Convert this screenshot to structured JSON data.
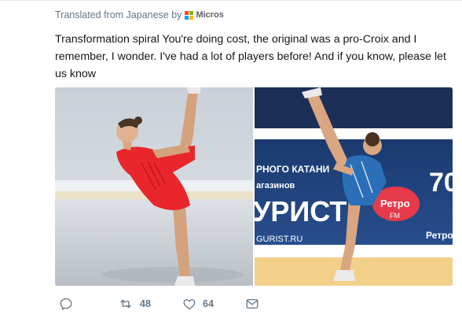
{
  "translation": {
    "label": "Translated from Japanese by",
    "brand": "Micros",
    "logo_colors": [
      "#f25022",
      "#7fba00",
      "#00a4ef",
      "#ffb900"
    ]
  },
  "tweet": {
    "text": "Transformation spiral You're doing cost, the original was a pro-Croix and I remember, I wonder. I've had a lot of players before! And if you know, please let us know"
  },
  "media": {
    "photo_left_icon": "skater-red-dress-photo",
    "photo_right": {
      "icon": "skater-blue-dress-photo",
      "banner_line1": "РНОГО КАТАНИ",
      "banner_line2": "агазинов",
      "banner_big": "УРИСТ",
      "banner_url": "GURIST.RU",
      "retro_logo": "Ретро",
      "retro_sub": "FM",
      "side_number": "70",
      "side_text": "Ретро"
    }
  },
  "actions": {
    "reply": {
      "icon": "reply-icon",
      "count": ""
    },
    "retweet": {
      "icon": "retweet-icon",
      "count": "48"
    },
    "like": {
      "icon": "heart-icon",
      "count": "64"
    },
    "dm": {
      "icon": "envelope-icon",
      "count": ""
    }
  },
  "colors": {
    "secondary_text": "#657786",
    "primary_text": "#14171a"
  }
}
